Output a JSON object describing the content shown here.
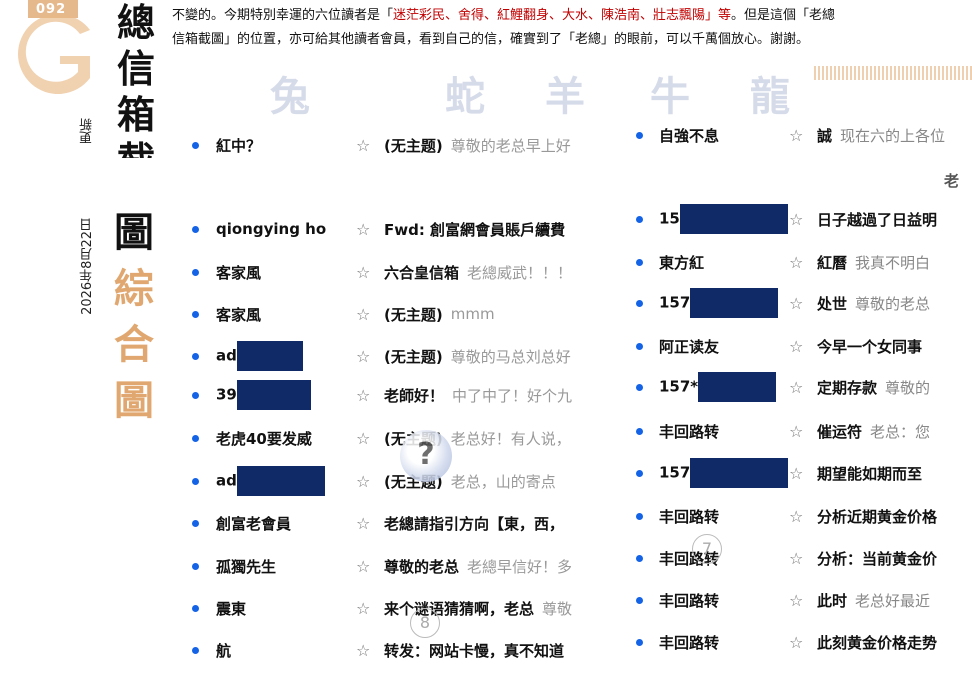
{
  "logo": {
    "number": "092",
    "letter": "G"
  },
  "title": {
    "top_chars": [
      "總",
      "信",
      "箱",
      "截"
    ],
    "bottom_chars": [
      "圖",
      "綜",
      "合",
      "圖"
    ]
  },
  "side_text": {
    "update_label": "更新",
    "date": "2026年8月22日"
  },
  "intro": {
    "line1_start": "不變的。今期特別幸運的六位讀者是「",
    "line1_names": "迷茫彩民、舍得、紅鯉翻身、大水、陳浩南、壯志飄陽",
    "line1_end": "」等。但是這個「老總",
    "line2": "信箱截圖」的位置，亦可給其他讀者會員，看到自己的信，確實到了「老總」的眼前，可以千萬個放心。謝謝。"
  },
  "zodiac": [
    "兔",
    "蛇",
    "羊",
    "牛",
    "龍"
  ],
  "left_mails": [
    {
      "sender": "紅中？",
      "redacted": false,
      "subject": "(无主题)",
      "preview": "尊敬的老总早上好"
    },
    {
      "sender": "qiongying ho",
      "redacted": false,
      "subject": "Fwd: 創富網會員賬戶續費",
      "preview": ""
    },
    {
      "sender": "客家風",
      "redacted": false,
      "subject": "六合皇信箱",
      "preview": "老總威武！！！"
    },
    {
      "sender": "客家風",
      "redacted": false,
      "subject": "(无主题)",
      "preview": "mmm"
    },
    {
      "sender": "ad",
      "redacted": true,
      "subject": "(无主题)",
      "preview": "尊敬的马总刘总好"
    },
    {
      "sender": "39",
      "redacted": true,
      "subject": "老師好！",
      "preview": "中了中了！好个九"
    },
    {
      "sender": "老虎40要发威",
      "redacted": false,
      "subject": "(无主题)",
      "preview": "老总好！有人说，"
    },
    {
      "sender": "ad",
      "redacted": true,
      "subject": "(无主题)",
      "preview": "老总，山的寄点"
    },
    {
      "sender": "創富老會員",
      "redacted": false,
      "subject": "老總請指引方向【東，西，",
      "preview": ""
    },
    {
      "sender": "孤獨先生",
      "redacted": false,
      "subject": "尊敬的老总",
      "preview": "老總早信好！多"
    },
    {
      "sender": "震東",
      "redacted": false,
      "subject": "来个谜语猜猜啊，老总",
      "preview": "尊敬"
    },
    {
      "sender": "航",
      "redacted": false,
      "subject": "转发：网站卡慢，真不知道",
      "preview": ""
    }
  ],
  "right_mails": [
    {
      "sender": "自強不息",
      "redacted": false,
      "subject": "誠",
      "preview": "现在六的上各位"
    },
    {
      "sender": "15",
      "redacted": true,
      "subject": "日子越過了日益明",
      "preview": ""
    },
    {
      "sender": "東方紅",
      "redacted": false,
      "subject": "紅曆",
      "preview": "我真不明白"
    },
    {
      "sender": "157",
      "redacted": true,
      "subject": "处世",
      "preview": "尊敬的老总"
    },
    {
      "sender": "阿正读友",
      "redacted": false,
      "subject": "今早一个女同事",
      "preview": ""
    },
    {
      "sender": "157*",
      "redacted": true,
      "subject": "定期存款",
      "preview": "尊敬的"
    },
    {
      "sender": "丰回路转",
      "redacted": false,
      "subject": "催运符",
      "preview": "老总：您"
    },
    {
      "sender": "157",
      "redacted": true,
      "subject": "期望能如期而至",
      "preview": ""
    },
    {
      "sender": "丰回路转",
      "redacted": false,
      "subject": "分析近期黄金价格",
      "preview": ""
    },
    {
      "sender": "丰回路转",
      "redacted": false,
      "subject": "分析：当前黄金价",
      "preview": ""
    },
    {
      "sender": "丰回路转",
      "redacted": false,
      "subject": "此时",
      "preview": "老总好最近"
    },
    {
      "sender": "丰回路转",
      "redacted": false,
      "subject": "此刻黄金价格走势",
      "preview": ""
    }
  ],
  "star_glyph": "☆",
  "question_mark": "?",
  "watermark_numbers": [
    "7",
    "8"
  ],
  "edge_char": "老"
}
